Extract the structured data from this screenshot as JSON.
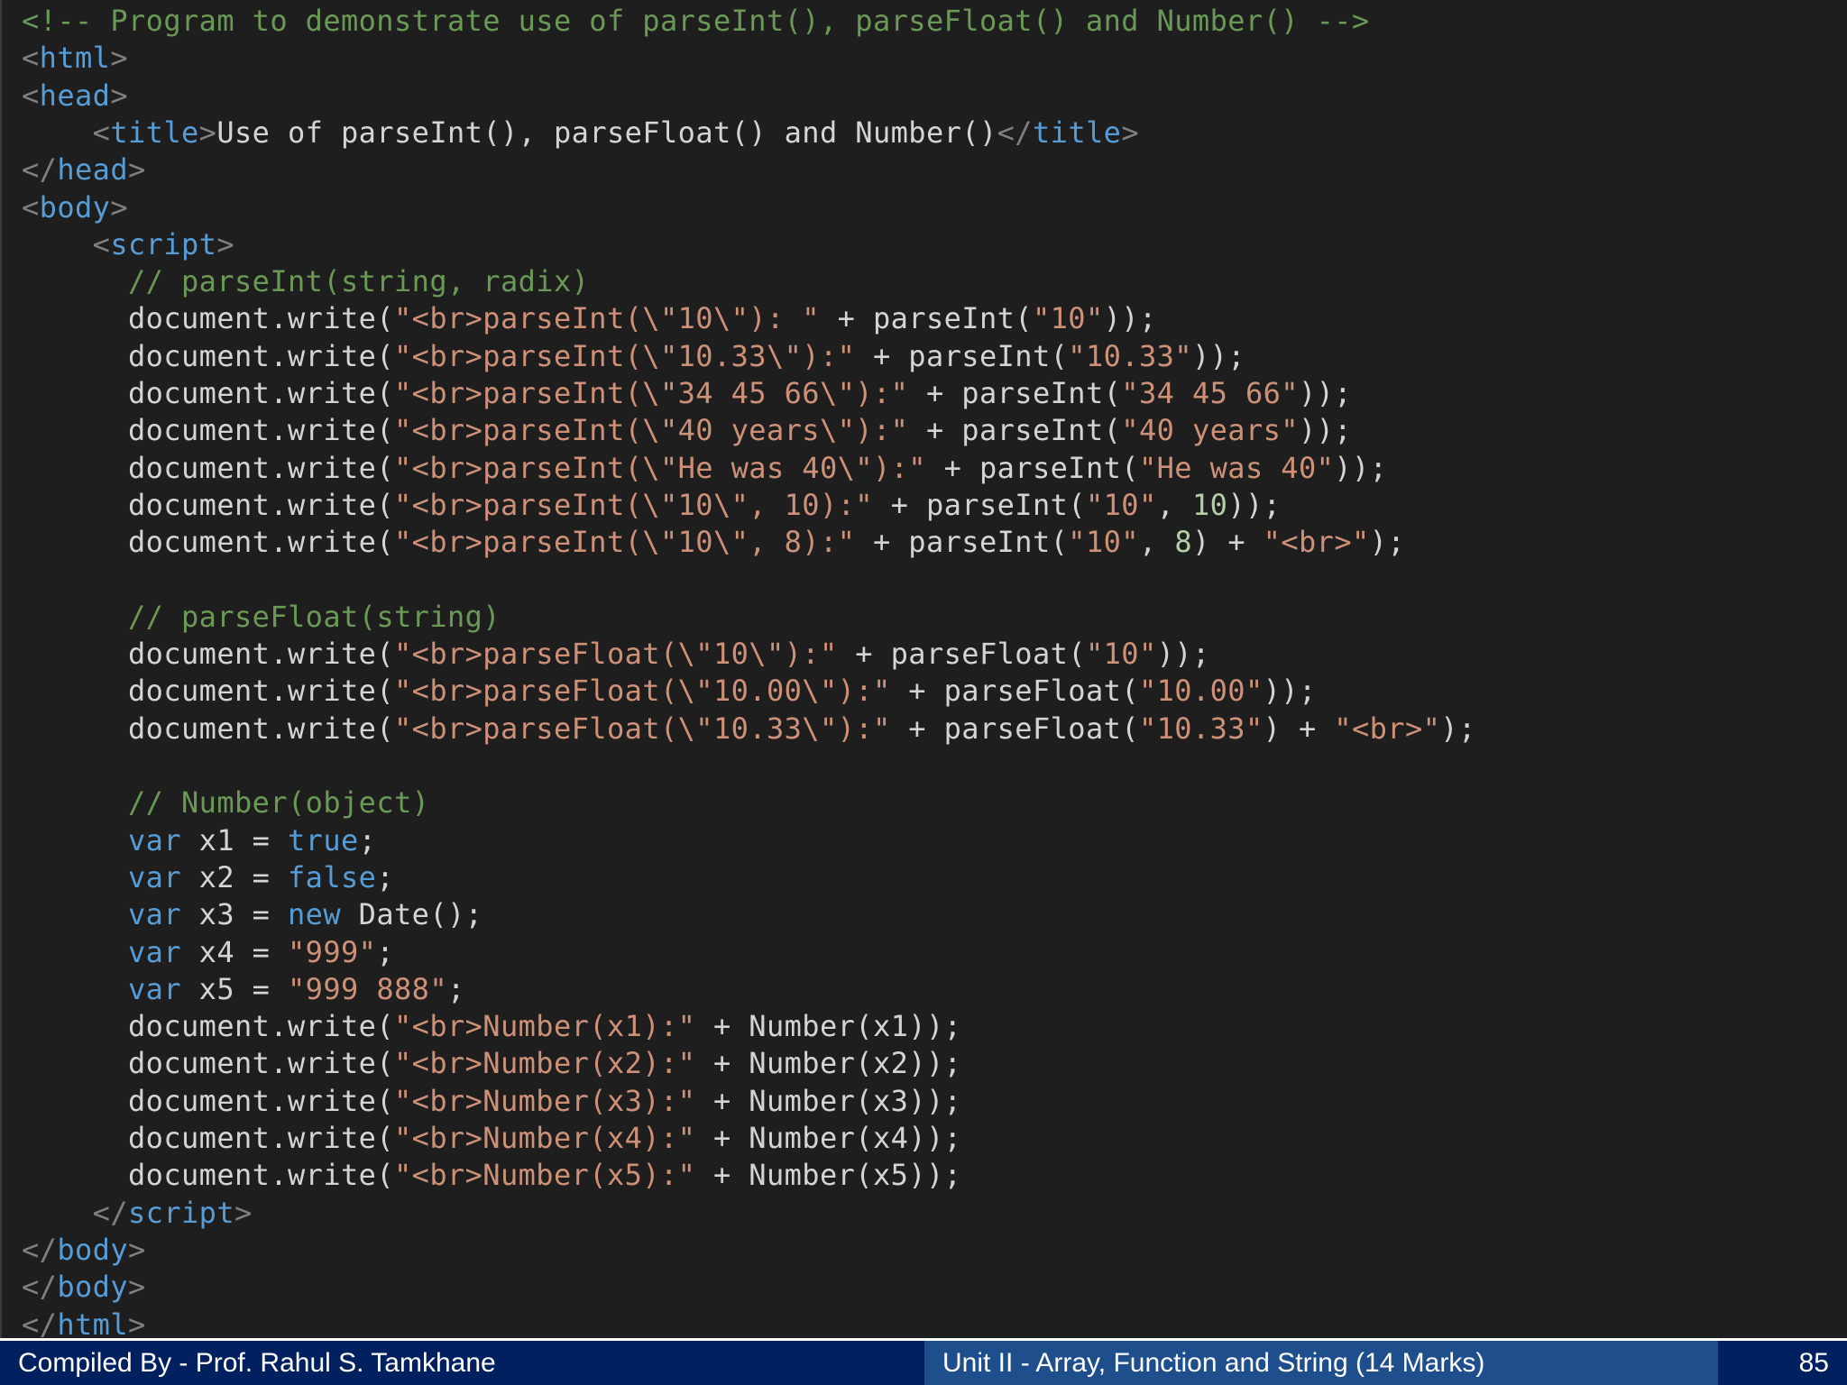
{
  "code_lines": [
    [
      [
        "c",
        "<!-- Program to demonstrate use of parseInt(), parseFloat() and Number() -->"
      ]
    ],
    [
      [
        "b",
        "<"
      ],
      [
        "t",
        "html"
      ],
      [
        "b",
        ">"
      ]
    ],
    [
      [
        "b",
        "<"
      ],
      [
        "t",
        "head"
      ],
      [
        "b",
        ">"
      ]
    ],
    [
      [
        "p",
        "    "
      ],
      [
        "b",
        "<"
      ],
      [
        "t",
        "title"
      ],
      [
        "b",
        ">"
      ],
      [
        "p",
        "Use of parseInt(), parseFloat() and Number()"
      ],
      [
        "b",
        "</"
      ],
      [
        "t",
        "title"
      ],
      [
        "b",
        ">"
      ]
    ],
    [
      [
        "b",
        "</"
      ],
      [
        "t",
        "head"
      ],
      [
        "b",
        ">"
      ]
    ],
    [
      [
        "b",
        "<"
      ],
      [
        "t",
        "body"
      ],
      [
        "b",
        ">"
      ]
    ],
    [
      [
        "p",
        "    "
      ],
      [
        "b",
        "<"
      ],
      [
        "t",
        "script"
      ],
      [
        "b",
        ">"
      ]
    ],
    [
      [
        "p",
        "      "
      ],
      [
        "c",
        "// parseInt(string, radix)"
      ]
    ],
    [
      [
        "p",
        "      document.write("
      ],
      [
        "s",
        "\"<br>parseInt(\\\"10\\\"): \""
      ],
      [
        "p",
        " + parseInt("
      ],
      [
        "s",
        "\"10\""
      ],
      [
        "p",
        "));"
      ]
    ],
    [
      [
        "p",
        "      document.write("
      ],
      [
        "s",
        "\"<br>parseInt(\\\"10.33\\\"):\""
      ],
      [
        "p",
        " + parseInt("
      ],
      [
        "s",
        "\"10.33\""
      ],
      [
        "p",
        "));"
      ]
    ],
    [
      [
        "p",
        "      document.write("
      ],
      [
        "s",
        "\"<br>parseInt(\\\"34 45 66\\\"):\""
      ],
      [
        "p",
        " + parseInt("
      ],
      [
        "s",
        "\"34 45 66\""
      ],
      [
        "p",
        "));"
      ]
    ],
    [
      [
        "p",
        "      document.write("
      ],
      [
        "s",
        "\"<br>parseInt(\\\"40 years\\\"):\""
      ],
      [
        "p",
        " + parseInt("
      ],
      [
        "s",
        "\"40 years\""
      ],
      [
        "p",
        "));"
      ]
    ],
    [
      [
        "p",
        "      document.write("
      ],
      [
        "s",
        "\"<br>parseInt(\\\"He was 40\\\"):\""
      ],
      [
        "p",
        " + parseInt("
      ],
      [
        "s",
        "\"He was 40\""
      ],
      [
        "p",
        "));"
      ]
    ],
    [
      [
        "p",
        "      document.write("
      ],
      [
        "s",
        "\"<br>parseInt(\\\"10\\\", 10):\""
      ],
      [
        "p",
        " + parseInt("
      ],
      [
        "s",
        "\"10\""
      ],
      [
        "p",
        ", "
      ],
      [
        "n",
        "10"
      ],
      [
        "p",
        "));"
      ]
    ],
    [
      [
        "p",
        "      document.write("
      ],
      [
        "s",
        "\"<br>parseInt(\\\"10\\\", 8):\""
      ],
      [
        "p",
        " + parseInt("
      ],
      [
        "s",
        "\"10\""
      ],
      [
        "p",
        ", "
      ],
      [
        "n",
        "8"
      ],
      [
        "p",
        ") + "
      ],
      [
        "s",
        "\"<br>\""
      ],
      [
        "p",
        ");"
      ]
    ],
    [],
    [
      [
        "p",
        "      "
      ],
      [
        "c",
        "// parseFloat(string)"
      ]
    ],
    [
      [
        "p",
        "      document.write("
      ],
      [
        "s",
        "\"<br>parseFloat(\\\"10\\\"):\""
      ],
      [
        "p",
        " + parseFloat("
      ],
      [
        "s",
        "\"10\""
      ],
      [
        "p",
        "));"
      ]
    ],
    [
      [
        "p",
        "      document.write("
      ],
      [
        "s",
        "\"<br>parseFloat(\\\"10.00\\\"):\""
      ],
      [
        "p",
        " + parseFloat("
      ],
      [
        "s",
        "\"10.00\""
      ],
      [
        "p",
        "));"
      ]
    ],
    [
      [
        "p",
        "      document.write("
      ],
      [
        "s",
        "\"<br>parseFloat(\\\"10.33\\\"):\""
      ],
      [
        "p",
        " + parseFloat("
      ],
      [
        "s",
        "\"10.33\""
      ],
      [
        "p",
        ") + "
      ],
      [
        "s",
        "\"<br>\""
      ],
      [
        "p",
        ");"
      ]
    ],
    [],
    [
      [
        "p",
        "      "
      ],
      [
        "c",
        "// Number(object)"
      ]
    ],
    [
      [
        "p",
        "      "
      ],
      [
        "k",
        "var"
      ],
      [
        "p",
        " x1 = "
      ],
      [
        "k",
        "true"
      ],
      [
        "p",
        ";"
      ]
    ],
    [
      [
        "p",
        "      "
      ],
      [
        "k",
        "var"
      ],
      [
        "p",
        " x2 = "
      ],
      [
        "k",
        "false"
      ],
      [
        "p",
        ";"
      ]
    ],
    [
      [
        "p",
        "      "
      ],
      [
        "k",
        "var"
      ],
      [
        "p",
        " x3 = "
      ],
      [
        "k",
        "new"
      ],
      [
        "p",
        " Date();"
      ]
    ],
    [
      [
        "p",
        "      "
      ],
      [
        "k",
        "var"
      ],
      [
        "p",
        " x4 = "
      ],
      [
        "s",
        "\"999\""
      ],
      [
        "p",
        ";"
      ]
    ],
    [
      [
        "p",
        "      "
      ],
      [
        "k",
        "var"
      ],
      [
        "p",
        " x5 = "
      ],
      [
        "s",
        "\"999 888\""
      ],
      [
        "p",
        ";"
      ]
    ],
    [
      [
        "p",
        "      document.write("
      ],
      [
        "s",
        "\"<br>Number(x1):\""
      ],
      [
        "p",
        " + Number(x1));"
      ]
    ],
    [
      [
        "p",
        "      document.write("
      ],
      [
        "s",
        "\"<br>Number(x2):\""
      ],
      [
        "p",
        " + Number(x2));"
      ]
    ],
    [
      [
        "p",
        "      document.write("
      ],
      [
        "s",
        "\"<br>Number(x3):\""
      ],
      [
        "p",
        " + Number(x3));"
      ]
    ],
    [
      [
        "p",
        "      document.write("
      ],
      [
        "s",
        "\"<br>Number(x4):\""
      ],
      [
        "p",
        " + Number(x4));"
      ]
    ],
    [
      [
        "p",
        "      document.write("
      ],
      [
        "s",
        "\"<br>Number(x5):\""
      ],
      [
        "p",
        " + Number(x5));"
      ]
    ],
    [
      [
        "p",
        "    "
      ],
      [
        "b",
        "</"
      ],
      [
        "t",
        "script"
      ],
      [
        "b",
        ">"
      ]
    ],
    [
      [
        "b",
        "</"
      ],
      [
        "t",
        "body"
      ],
      [
        "b",
        ">"
      ]
    ],
    [
      [
        "b",
        "</"
      ],
      [
        "t",
        "body"
      ],
      [
        "b",
        ">"
      ]
    ],
    [
      [
        "b",
        "</"
      ],
      [
        "t",
        "html"
      ],
      [
        "b",
        ">"
      ]
    ]
  ],
  "colors": {
    "background": "#1e1e1e",
    "comment": "#6a9955",
    "tag": "#569cd6",
    "string": "#ce9178",
    "plain": "#d4d4d4",
    "footer_dark": "#002060",
    "footer_mid": "#1f4e8c"
  },
  "footer": {
    "author": "Compiled By - Prof. Rahul S. Tamkhane",
    "unit": "Unit II - Array, Function and String (14 Marks)",
    "page_number": "85"
  }
}
